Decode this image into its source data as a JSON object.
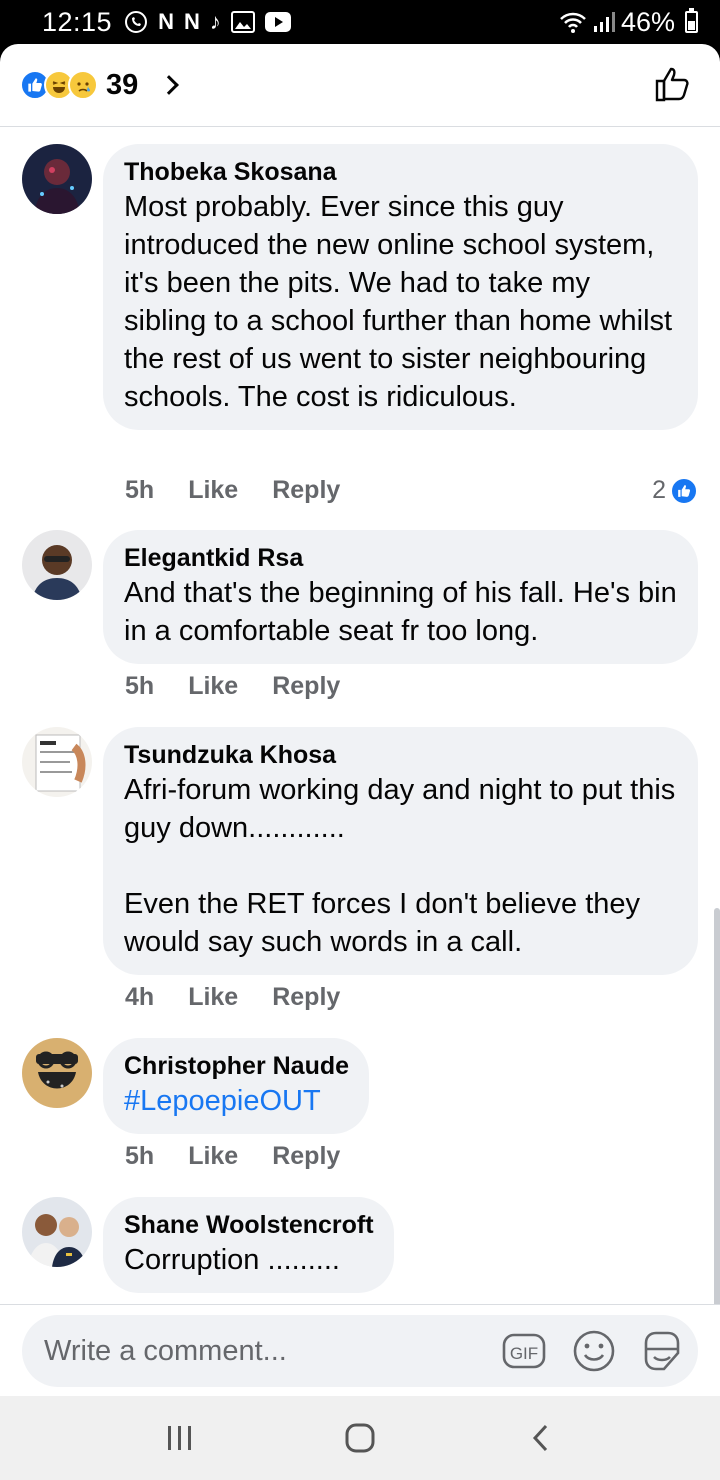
{
  "status_bar": {
    "time": "12:15",
    "notification_icons": [
      "whatsapp-icon",
      "netflix-icon",
      "netflix-icon",
      "tiktok-icon",
      "gallery-icon",
      "youtube-icon"
    ],
    "battery": "46%"
  },
  "header": {
    "reaction_count": "39",
    "reactions": [
      "like",
      "haha",
      "sad"
    ]
  },
  "comments": [
    {
      "author": "Thobeka Skosana",
      "text": "Most probably. Ever since this guy introduced the new online school system, it's been the pits. We had to take my sibling to a school further than home whilst the rest of us went to sister neighbouring schools. The cost is ridiculous.",
      "time": "5h",
      "like_label": "Like",
      "reply_label": "Reply",
      "likes": "2"
    },
    {
      "author": "Elegantkid Rsa",
      "text": "And that's the beginning of his fall. He's bin in a comfortable seat fr too long.",
      "time": "5h",
      "like_label": "Like",
      "reply_label": "Reply"
    },
    {
      "author": "Tsundzuka Khosa",
      "text": "Afri-forum working day and night to put this guy down............\n\nEven the RET forces I don't believe they would say such words in a call.",
      "time": "4h",
      "like_label": "Like",
      "reply_label": "Reply"
    },
    {
      "author": "Christopher Naude",
      "text": "#LepoepieOUT",
      "time": "5h",
      "like_label": "Like",
      "reply_label": "Reply"
    },
    {
      "author": "Shane Woolstencroft",
      "text": "Corruption .........",
      "time": "",
      "like_label": "",
      "reply_label": ""
    }
  ],
  "composer": {
    "placeholder": "Write a comment...",
    "gif_label": "GIF"
  },
  "colors": {
    "accent": "#1877f2",
    "bubble": "#f0f2f5",
    "muted_text": "#65676b"
  }
}
